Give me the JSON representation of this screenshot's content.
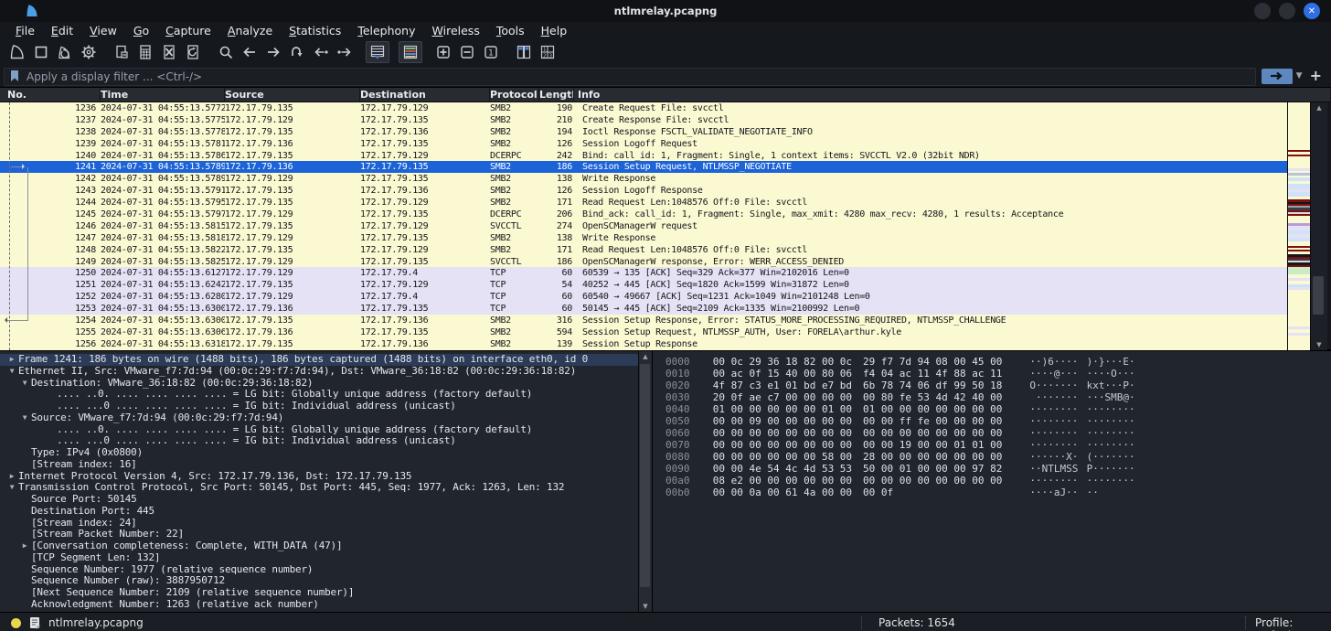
{
  "window": {
    "title": "ntlmrelay.pcapng"
  },
  "menu": {
    "items": [
      "File",
      "Edit",
      "View",
      "Go",
      "Capture",
      "Analyze",
      "Statistics",
      "Telephony",
      "Wireless",
      "Tools",
      "Help"
    ]
  },
  "toolbar": {
    "icons": [
      {
        "icon": "capture-start",
        "gap": false,
        "active": false
      },
      {
        "icon": "capture-stop",
        "gap": false,
        "active": false
      },
      {
        "icon": "capture-restart",
        "gap": false,
        "active": false
      },
      {
        "icon": "capture-options",
        "gap": false,
        "active": false
      },
      {
        "icon": "open-file",
        "gap": true,
        "active": false
      },
      {
        "icon": "save-file",
        "gap": false,
        "active": false
      },
      {
        "icon": "close-file",
        "gap": false,
        "active": false
      },
      {
        "icon": "reload-file",
        "gap": false,
        "active": false
      },
      {
        "icon": "find-packet",
        "gap": true,
        "active": false
      },
      {
        "icon": "go-back",
        "gap": false,
        "active": false
      },
      {
        "icon": "go-forward",
        "gap": false,
        "active": false
      },
      {
        "icon": "go-to-packet",
        "gap": false,
        "active": false
      },
      {
        "icon": "previous-packet",
        "gap": false,
        "active": false
      },
      {
        "icon": "next-packet",
        "gap": false,
        "active": false
      },
      {
        "icon": "auto-scroll",
        "gap": true,
        "active": true
      },
      {
        "icon": "colorize",
        "gap": true,
        "active": true
      },
      {
        "icon": "zoom-in",
        "gap": true,
        "active": false
      },
      {
        "icon": "zoom-out",
        "gap": false,
        "active": false
      },
      {
        "icon": "zoom-original",
        "gap": false,
        "active": false
      },
      {
        "icon": "resize-columns",
        "gap": true,
        "active": false
      },
      {
        "icon": "number-columns",
        "gap": false,
        "active": false
      }
    ]
  },
  "filter_bar": {
    "placeholder": "Apply a display filter ... <Ctrl-/>"
  },
  "packet_list": {
    "columns": [
      "No.",
      "Time",
      "Source",
      "Destination",
      "Protocol",
      "Length",
      "Info"
    ],
    "rows": [
      {
        "no": "1236",
        "time": "2024-07-31 04:55:13.5772…",
        "src": "172.17.79.135",
        "dst": "172.17.79.129",
        "proto": "SMB2",
        "len": "190",
        "info": "Create Request File: svcctl",
        "type": "smb",
        "mark": null
      },
      {
        "no": "1237",
        "time": "2024-07-31 04:55:13.5775…",
        "src": "172.17.79.129",
        "dst": "172.17.79.135",
        "proto": "SMB2",
        "len": "210",
        "info": "Create Response File: svcctl",
        "type": "smb",
        "mark": null
      },
      {
        "no": "1238",
        "time": "2024-07-31 04:55:13.5778…",
        "src": "172.17.79.135",
        "dst": "172.17.79.136",
        "proto": "SMB2",
        "len": "194",
        "info": "Ioctl Response FSCTL_VALIDATE_NEGOTIATE_INFO",
        "type": "smb",
        "mark": null
      },
      {
        "no": "1239",
        "time": "2024-07-31 04:55:13.5781…",
        "src": "172.17.79.136",
        "dst": "172.17.79.135",
        "proto": "SMB2",
        "len": "126",
        "info": "Session Logoff Request",
        "type": "smb",
        "mark": null
      },
      {
        "no": "1240",
        "time": "2024-07-31 04:55:13.5786…",
        "src": "172.17.79.135",
        "dst": "172.17.79.129",
        "proto": "DCERPC",
        "len": "242",
        "info": "Bind: call_id: 1, Fragment: Single, 1 context items: SVCCTL V2.0 (32bit NDR)",
        "type": "smb",
        "mark": null
      },
      {
        "no": "1241",
        "time": "2024-07-31 04:55:13.5789…",
        "src": "172.17.79.136",
        "dst": "172.17.79.135",
        "proto": "SMB2",
        "len": "186",
        "info": "Session Setup Request, NTLMSSP_NEGOTIATE",
        "type": "smb",
        "mark": "right",
        "selected": true
      },
      {
        "no": "1242",
        "time": "2024-07-31 04:55:13.5789…",
        "src": "172.17.79.129",
        "dst": "172.17.79.135",
        "proto": "SMB2",
        "len": "138",
        "info": "Write Response",
        "type": "smb",
        "mark": null
      },
      {
        "no": "1243",
        "time": "2024-07-31 04:55:13.5791…",
        "src": "172.17.79.135",
        "dst": "172.17.79.136",
        "proto": "SMB2",
        "len": "126",
        "info": "Session Logoff Response",
        "type": "smb",
        "mark": null
      },
      {
        "no": "1244",
        "time": "2024-07-31 04:55:13.5795…",
        "src": "172.17.79.135",
        "dst": "172.17.79.129",
        "proto": "SMB2",
        "len": "171",
        "info": "Read Request Len:1048576 Off:0 File: svcctl",
        "type": "smb",
        "mark": null
      },
      {
        "no": "1245",
        "time": "2024-07-31 04:55:13.5797…",
        "src": "172.17.79.129",
        "dst": "172.17.79.135",
        "proto": "DCERPC",
        "len": "206",
        "info": "Bind_ack: call_id: 1, Fragment: Single, max_xmit: 4280 max_recv: 4280, 1 results: Acceptance",
        "type": "smb",
        "mark": null
      },
      {
        "no": "1246",
        "time": "2024-07-31 04:55:13.5815…",
        "src": "172.17.79.135",
        "dst": "172.17.79.129",
        "proto": "SVCCTL",
        "len": "274",
        "info": "OpenSCManagerW request",
        "type": "smb",
        "mark": null
      },
      {
        "no": "1247",
        "time": "2024-07-31 04:55:13.5818…",
        "src": "172.17.79.129",
        "dst": "172.17.79.135",
        "proto": "SMB2",
        "len": "138",
        "info": "Write Response",
        "type": "smb",
        "mark": null
      },
      {
        "no": "1248",
        "time": "2024-07-31 04:55:13.5822…",
        "src": "172.17.79.135",
        "dst": "172.17.79.129",
        "proto": "SMB2",
        "len": "171",
        "info": "Read Request Len:1048576 Off:0 File: svcctl",
        "type": "smb",
        "mark": null
      },
      {
        "no": "1249",
        "time": "2024-07-31 04:55:13.5825…",
        "src": "172.17.79.129",
        "dst": "172.17.79.135",
        "proto": "SVCCTL",
        "len": "186",
        "info": "OpenSCManagerW response, Error: WERR_ACCESS_DENIED",
        "type": "smb",
        "mark": null
      },
      {
        "no": "1250",
        "time": "2024-07-31 04:55:13.6127…",
        "src": "172.17.79.129",
        "dst": "172.17.79.4",
        "proto": "TCP",
        "len": "60",
        "info": "60539 → 135 [ACK] Seq=329 Ack=377 Win=2102016 Len=0",
        "type": "tcp",
        "mark": null
      },
      {
        "no": "1251",
        "time": "2024-07-31 04:55:13.6242…",
        "src": "172.17.79.135",
        "dst": "172.17.79.129",
        "proto": "TCP",
        "len": "54",
        "info": "40252 → 445 [ACK] Seq=1820 Ack=1599 Win=31872 Len=0",
        "type": "tcp",
        "mark": null
      },
      {
        "no": "1252",
        "time": "2024-07-31 04:55:13.6280…",
        "src": "172.17.79.129",
        "dst": "172.17.79.4",
        "proto": "TCP",
        "len": "60",
        "info": "60540 → 49667 [ACK] Seq=1231 Ack=1049 Win=2101248 Len=0",
        "type": "tcp",
        "mark": null
      },
      {
        "no": "1253",
        "time": "2024-07-31 04:55:13.6300…",
        "src": "172.17.79.136",
        "dst": "172.17.79.135",
        "proto": "TCP",
        "len": "60",
        "info": "50145 → 445 [ACK] Seq=2109 Ack=1335 Win=2100992 Len=0",
        "type": "tcp",
        "mark": null
      },
      {
        "no": "1254",
        "time": "2024-07-31 04:55:13.6300…",
        "src": "172.17.79.135",
        "dst": "172.17.79.136",
        "proto": "SMB2",
        "len": "316",
        "info": "Session Setup Response, Error: STATUS_MORE_PROCESSING_REQUIRED, NTLMSSP_CHALLENGE",
        "type": "smb",
        "mark": "left"
      },
      {
        "no": "1255",
        "time": "2024-07-31 04:55:13.6306…",
        "src": "172.17.79.136",
        "dst": "172.17.79.135",
        "proto": "SMB2",
        "len": "594",
        "info": "Session Setup Request, NTLMSSP_AUTH, User: FORELA\\arthur.kyle",
        "type": "smb",
        "mark": null
      },
      {
        "no": "1256",
        "time": "2024-07-31 04:55:13.6318…",
        "src": "172.17.79.135",
        "dst": "172.17.79.136",
        "proto": "SMB2",
        "len": "139",
        "info": "Session Setup Response",
        "type": "smb",
        "mark": null
      }
    ],
    "minimap": [
      {
        "c": "#fbf9d2",
        "h": 52
      },
      {
        "c": "#7e1010",
        "h": 2
      },
      {
        "c": "#fbf9d2",
        "h": 3
      },
      {
        "c": "#7e1010",
        "h": 2
      },
      {
        "c": "#fbf9d2",
        "h": 13
      },
      {
        "c": "#e4e2f4",
        "h": 3
      },
      {
        "c": "#fbf9d2",
        "h": 2
      },
      {
        "c": "#b9c2dd",
        "h": 3
      },
      {
        "c": "#fbf9d2",
        "h": 2
      },
      {
        "c": "#cfe2f7",
        "h": 4
      },
      {
        "c": "#fbf9d2",
        "h": 3
      },
      {
        "c": "#cfe2f7",
        "h": 6
      },
      {
        "c": "#e4e2f4",
        "h": 3
      },
      {
        "c": "#cfe2f7",
        "h": 5
      },
      {
        "c": "#fbf9d2",
        "h": 3
      },
      {
        "c": "#7e1010",
        "h": 3
      },
      {
        "c": "#15151a",
        "h": 2
      },
      {
        "c": "#7e1010",
        "h": 2
      },
      {
        "c": "#9aa0a8",
        "h": 2
      },
      {
        "c": "#3a3f48",
        "h": 3
      },
      {
        "c": "#7e1010",
        "h": 2
      },
      {
        "c": "#d8dade",
        "h": 2
      },
      {
        "c": "#7e1010",
        "h": 2
      },
      {
        "c": "#fbf9d2",
        "h": 8
      },
      {
        "c": "#b99bd8",
        "h": 3
      },
      {
        "c": "#e4e2f4",
        "h": 5
      },
      {
        "c": "#cfe2f7",
        "h": 4
      },
      {
        "c": "#e4e2f4",
        "h": 4
      },
      {
        "c": "#cfe2f7",
        "h": 4
      },
      {
        "c": "#fbf9d2",
        "h": 5
      },
      {
        "c": "#7e1010",
        "h": 2
      },
      {
        "c": "#fbf9d2",
        "h": 2
      },
      {
        "c": "#7e1010",
        "h": 2
      },
      {
        "c": "#fbf9d2",
        "h": 3
      },
      {
        "c": "#15151a",
        "h": 3
      },
      {
        "c": "#7e1010",
        "h": 2
      },
      {
        "c": "#3a3f48",
        "h": 2
      },
      {
        "c": "#d8dade",
        "h": 2
      },
      {
        "c": "#15151a",
        "h": 3
      },
      {
        "c": "#7e1010",
        "h": 2
      },
      {
        "c": "#c9ecc4",
        "h": 8
      },
      {
        "c": "#fbf9d2",
        "h": 4
      },
      {
        "c": "#e4e2f4",
        "h": 3
      },
      {
        "c": "#fbf9d2",
        "h": 4
      },
      {
        "c": "#cfe2f7",
        "h": 3
      },
      {
        "c": "#e4e2f4",
        "h": 3
      },
      {
        "c": "#fbf9d2",
        "h": 40
      },
      {
        "c": "#e4e2f4",
        "h": 3
      },
      {
        "c": "#fbf9d2",
        "h": 4
      },
      {
        "c": "#e4e2f4",
        "h": 3
      },
      {
        "c": "#fbf9d2",
        "h": 16
      }
    ]
  },
  "detail_pane": {
    "lines": [
      {
        "e": "r",
        "i": 0,
        "hl": true,
        "t": "Frame 1241: 186 bytes on wire (1488 bits), 186 bytes captured (1488 bits) on interface eth0, id 0"
      },
      {
        "e": "d",
        "i": 0,
        "t": "Ethernet II, Src: VMware_f7:7d:94 (00:0c:29:f7:7d:94), Dst: VMware_36:18:82 (00:0c:29:36:18:82)"
      },
      {
        "e": "d",
        "i": 1,
        "t": "Destination: VMware_36:18:82 (00:0c:29:36:18:82)"
      },
      {
        "e": null,
        "i": 3,
        "t": ".... ..0. .... .... .... .... = LG bit: Globally unique address (factory default)"
      },
      {
        "e": null,
        "i": 3,
        "t": ".... ...0 .... .... .... .... = IG bit: Individual address (unicast)"
      },
      {
        "e": "d",
        "i": 1,
        "t": "Source: VMware_f7:7d:94 (00:0c:29:f7:7d:94)"
      },
      {
        "e": null,
        "i": 3,
        "t": ".... ..0. .... .... .... .... = LG bit: Globally unique address (factory default)"
      },
      {
        "e": null,
        "i": 3,
        "t": ".... ...0 .... .... .... .... = IG bit: Individual address (unicast)"
      },
      {
        "e": null,
        "i": 1,
        "t": "Type: IPv4 (0x0800)"
      },
      {
        "e": null,
        "i": 1,
        "t": "[Stream index: 16]"
      },
      {
        "e": "r",
        "i": 0,
        "t": "Internet Protocol Version 4, Src: 172.17.79.136, Dst: 172.17.79.135"
      },
      {
        "e": "d",
        "i": 0,
        "t": "Transmission Control Protocol, Src Port: 50145, Dst Port: 445, Seq: 1977, Ack: 1263, Len: 132"
      },
      {
        "e": null,
        "i": 1,
        "t": "Source Port: 50145"
      },
      {
        "e": null,
        "i": 1,
        "t": "Destination Port: 445"
      },
      {
        "e": null,
        "i": 1,
        "t": "[Stream index: 24]"
      },
      {
        "e": null,
        "i": 1,
        "t": "[Stream Packet Number: 22]"
      },
      {
        "e": "r",
        "i": 1,
        "t": "[Conversation completeness: Complete, WITH_DATA (47)]"
      },
      {
        "e": null,
        "i": 1,
        "t": "[TCP Segment Len: 132]"
      },
      {
        "e": null,
        "i": 1,
        "t": "Sequence Number: 1977    (relative sequence number)"
      },
      {
        "e": null,
        "i": 1,
        "t": "Sequence Number (raw): 3887950712"
      },
      {
        "e": null,
        "i": 1,
        "t": "[Next Sequence Number: 2109    (relative sequence number)]"
      },
      {
        "e": null,
        "i": 1,
        "t": "Acknowledgment Number: 1263    (relative ack number)"
      }
    ]
  },
  "hex_pane": {
    "rows": [
      {
        "offset": "0000",
        "h1": "00 0c 29 36 18 82 00 0c",
        "h2": "29 f7 7d 94 08 00 45 00",
        "a1": "··)6····",
        "a2": ")·}···E·"
      },
      {
        "offset": "0010",
        "h1": "00 ac 0f 15 40 00 80 06",
        "h2": "f4 04 ac 11 4f 88 ac 11",
        "a1": "····@···",
        "a2": "····O···"
      },
      {
        "offset": "0020",
        "h1": "4f 87 c3 e1 01 bd e7 bd",
        "h2": "6b 78 74 06 df 99 50 18",
        "a1": "O·······",
        "a2": "kxt···P·"
      },
      {
        "offset": "0030",
        "h1": "20 0f ae c7 00 00 00 00",
        "h2": "00 80 fe 53 4d 42 40 00",
        "a1": " ·······",
        "a2": "···SMB@·"
      },
      {
        "offset": "0040",
        "h1": "01 00 00 00 00 00 01 00",
        "h2": "01 00 00 00 00 00 00 00",
        "a1": "········",
        "a2": "········"
      },
      {
        "offset": "0050",
        "h1": "00 00 09 00 00 00 00 00",
        "h2": "00 00 ff fe 00 00 00 00",
        "a1": "········",
        "a2": "········"
      },
      {
        "offset": "0060",
        "h1": "00 00 00 00 00 00 00 00",
        "h2": "00 00 00 00 00 00 00 00",
        "a1": "········",
        "a2": "········"
      },
      {
        "offset": "0070",
        "h1": "00 00 00 00 00 00 00 00",
        "h2": "00 00 19 00 00 01 01 00",
        "a1": "········",
        "a2": "········"
      },
      {
        "offset": "0080",
        "h1": "00 00 00 00 00 00 58 00",
        "h2": "28 00 00 00 00 00 00 00",
        "a1": "······X·",
        "a2": "(·······"
      },
      {
        "offset": "0090",
        "h1": "00 00 4e 54 4c 4d 53 53",
        "h2": "50 00 01 00 00 00 97 82",
        "a1": "··NTLMSS",
        "a2": "P·······"
      },
      {
        "offset": "00a0",
        "h1": "08 e2 00 00 00 00 00 00",
        "h2": "00 00 00 00 00 00 00 00",
        "a1": "········",
        "a2": "········"
      },
      {
        "offset": "00b0",
        "h1": "00 00 0a 00 61 4a 00 00",
        "h2": "00 0f",
        "a1": "····aJ··",
        "a2": "··"
      }
    ]
  },
  "status_bar": {
    "filename": "ntlmrelay.pcapng",
    "packets_label": "Packets: 1654",
    "profile_label": "Profile: Default"
  },
  "colors": {
    "accent_blue": "#1d63d8",
    "row_yellow": "#fbf9d2",
    "row_lavender": "#e4e2f4",
    "close_button_blue": "#2f6fe4"
  }
}
